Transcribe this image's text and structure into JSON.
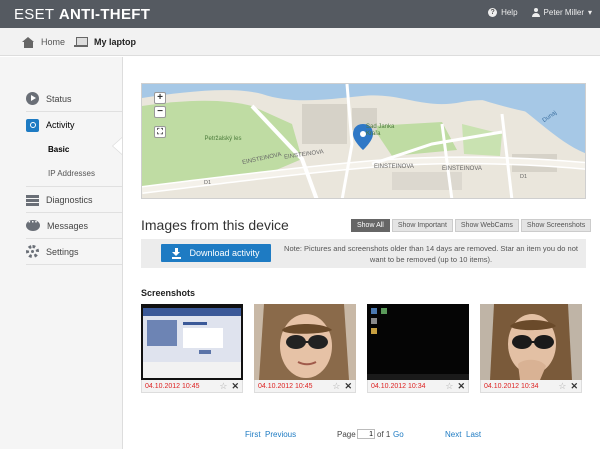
{
  "brand": {
    "eset": "ESET",
    "anti_theft": "ANTI-THEFT"
  },
  "topnav": {
    "help": "Help",
    "user": "Peter Miller"
  },
  "breadcrumb": {
    "home": "Home",
    "device": "My laptop"
  },
  "sidebar": {
    "status": "Status",
    "activity": "Activity",
    "basic": "Basic",
    "ip": "IP Addresses",
    "diagnostics": "Diagnostics",
    "messages": "Messages",
    "settings": "Settings"
  },
  "map": {
    "zoom_in": "+",
    "zoom_out": "−",
    "labels": {
      "street1": "EINSTEINOVA",
      "street2": "EINSTEINOVA",
      "street3": "EINSTEINOVA",
      "street4": "EINSTEINOVA",
      "park": "Petržalský les",
      "place": "Sad Janka Kráľa",
      "river": "Dunaj",
      "d1a": "D1",
      "d1b": "D1"
    }
  },
  "images": {
    "title": "Images from this device",
    "filters": [
      "Show All",
      "Show Important",
      "Show WebCams",
      "Show Screenshots"
    ],
    "active_filter": "Show All",
    "download_label": "Download activity",
    "notice": "Note: Pictures and screenshots older than 14 days are removed. Star an item you do not want to be removed (up to 10 items).",
    "section_label": "Screenshots",
    "items": [
      {
        "type": "screenshot-facebook",
        "timestamp": "04.10.2012 10:45"
      },
      {
        "type": "webcam",
        "timestamp": "04.10.2012 10:45"
      },
      {
        "type": "screenshot-desktop",
        "timestamp": "04.10.2012 10:34"
      },
      {
        "type": "webcam",
        "timestamp": "04.10.2012 10:34"
      }
    ]
  },
  "pager": {
    "first": "First",
    "previous": "Previous",
    "page_label": "Page",
    "page_value": "1",
    "of_label": "of 1",
    "go": "Go",
    "next": "Next",
    "last": "Last"
  },
  "colors": {
    "accent": "#1e7bc3",
    "topbar": "#555a61",
    "timestamp": "#dd2222"
  }
}
